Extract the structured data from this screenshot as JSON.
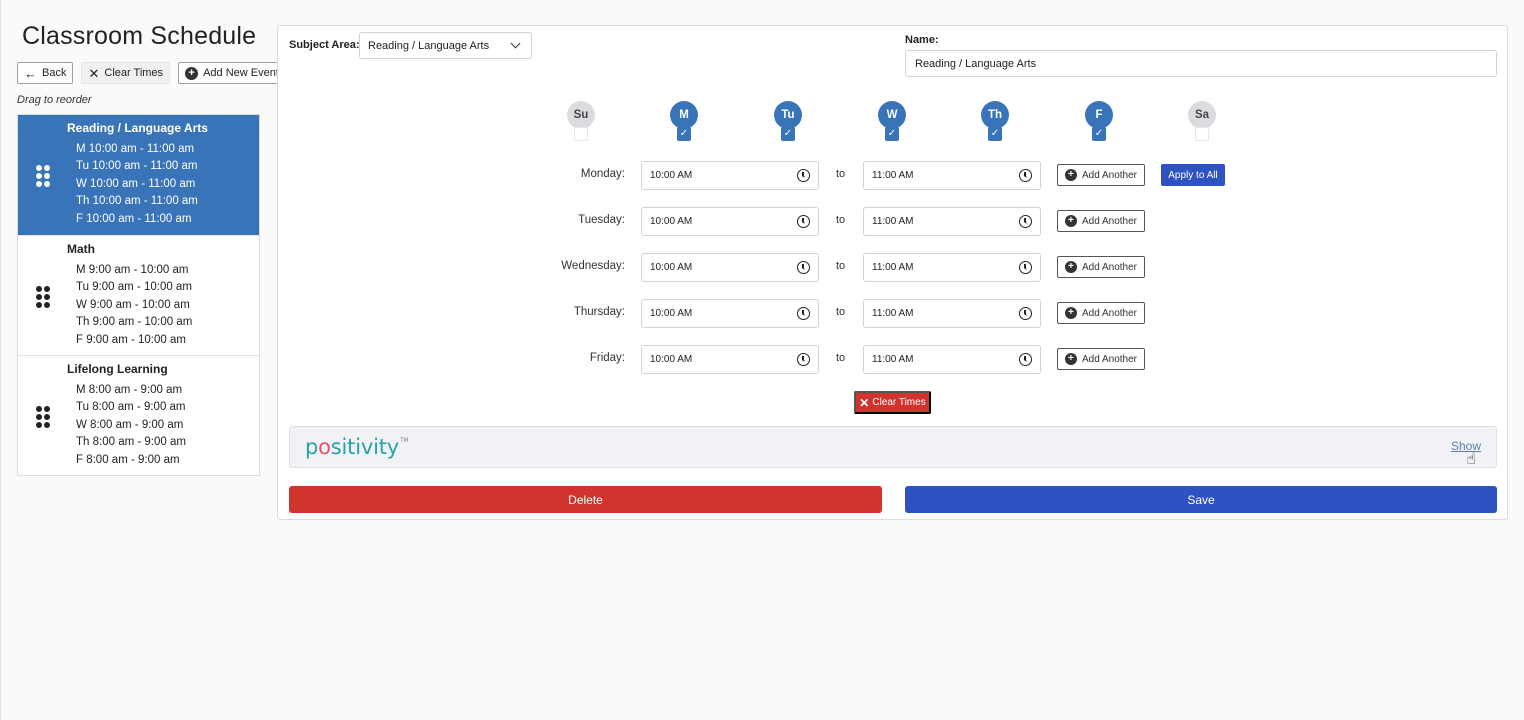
{
  "page": {
    "title": "Classroom Schedule"
  },
  "toolbar": {
    "back_label": "Back",
    "clear_label": "Clear Times",
    "add_label": "Add New Event"
  },
  "drag_hint": "Drag to reorder",
  "events": [
    {
      "title": "Reading / Language Arts",
      "active": true,
      "times": [
        "M 10:00 am - 11:00 am",
        "Tu 10:00 am - 11:00 am",
        "W 10:00 am - 11:00 am",
        "Th 10:00 am - 11:00 am",
        "F 10:00 am - 11:00 am"
      ]
    },
    {
      "title": "Math",
      "active": false,
      "times": [
        "M 9:00 am - 10:00 am",
        "Tu 9:00 am - 10:00 am",
        "W 9:00 am - 10:00 am",
        "Th 9:00 am - 10:00 am",
        "F 9:00 am - 10:00 am"
      ]
    },
    {
      "title": "Lifelong Learning",
      "active": false,
      "times": [
        "M 8:00 am - 9:00 am",
        "Tu 8:00 am - 9:00 am",
        "W 8:00 am - 9:00 am",
        "Th 8:00 am - 9:00 am",
        "F 8:00 am - 9:00 am"
      ]
    }
  ],
  "form": {
    "subject_label": "Subject Area:",
    "subject_value": "Reading / Language Arts",
    "name_label": "Name:",
    "name_value": "Reading / Language Arts"
  },
  "days": [
    {
      "abbr": "Su",
      "checked": false
    },
    {
      "abbr": "M",
      "checked": true
    },
    {
      "abbr": "Tu",
      "checked": true
    },
    {
      "abbr": "W",
      "checked": true
    },
    {
      "abbr": "Th",
      "checked": true
    },
    {
      "abbr": "F",
      "checked": true
    },
    {
      "abbr": "Sa",
      "checked": false
    }
  ],
  "schedule": {
    "to_label": "to",
    "add_another_label": "Add Another",
    "apply_all_label": "Apply to All",
    "clear_label": "Clear Times",
    "rows": [
      {
        "day": "Monday:",
        "start": "10:00 AM",
        "end": "11:00 AM"
      },
      {
        "day": "Tuesday:",
        "start": "10:00 AM",
        "end": "11:00 AM"
      },
      {
        "day": "Wednesday:",
        "start": "10:00 AM",
        "end": "11:00 AM"
      },
      {
        "day": "Thursday:",
        "start": "10:00 AM",
        "end": "11:00 AM"
      },
      {
        "day": "Friday:",
        "start": "10:00 AM",
        "end": "11:00 AM"
      }
    ]
  },
  "positivity": {
    "logo_p": "p",
    "logo_o": "o",
    "logo_rest": "sitivity",
    "logo_tm": "TM",
    "show_label": "Show"
  },
  "actions": {
    "delete_label": "Delete",
    "save_label": "Save"
  },
  "colors": {
    "primary": "#3a74b8",
    "save": "#2f52c2",
    "danger": "#d0342c",
    "brand_teal": "#27a3a8",
    "brand_pink": "#e2546e"
  }
}
